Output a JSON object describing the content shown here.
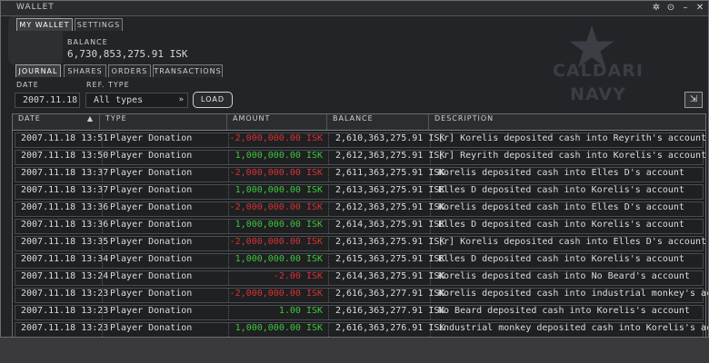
{
  "window": {
    "title": "WALLET"
  },
  "background": {
    "emblem_line1": "CALDARI",
    "emblem_line2": "NAVY"
  },
  "tabs_top": [
    "MY WALLET",
    "SETTINGS"
  ],
  "balance": {
    "label": "BALANCE",
    "value": "6,730,853,275.91",
    "unit": "ISK"
  },
  "tabs_sub": [
    "JOURNAL",
    "SHARES",
    "ORDERS",
    "TRANSACTIONS"
  ],
  "filters": {
    "date_label": "DATE",
    "date_value": "2007.11.18",
    "ref_type_label": "REF. TYPE",
    "ref_type_value": "All types",
    "load_label": "LOAD"
  },
  "table": {
    "columns": [
      "DATE",
      "TYPE",
      "AMOUNT",
      "BALANCE",
      "DESCRIPTION"
    ],
    "rows": [
      {
        "date": "2007.11.18 13:51",
        "type": "Player Donation",
        "amount": "-2,000,000.00",
        "balance": "2,610,363,275.91",
        "desc": "[r] Korelis deposited cash into Reyrith's account",
        "sign": "neg"
      },
      {
        "date": "2007.11.18 13:50",
        "type": "Player Donation",
        "amount": "1,000,000.00",
        "balance": "2,612,363,275.91",
        "desc": "[r] Reyrith deposited cash into Korelis's account",
        "sign": "pos"
      },
      {
        "date": "2007.11.18 13:37",
        "type": "Player Donation",
        "amount": "-2,000,000.00",
        "balance": "2,611,363,275.91",
        "desc": "Korelis deposited cash into Elles D's account",
        "sign": "neg"
      },
      {
        "date": "2007.11.18 13:37",
        "type": "Player Donation",
        "amount": "1,000,000.00",
        "balance": "2,613,363,275.91",
        "desc": "Elles D deposited cash into Korelis's account",
        "sign": "pos"
      },
      {
        "date": "2007.11.18 13:36",
        "type": "Player Donation",
        "amount": "-2,000,000.00",
        "balance": "2,612,363,275.91",
        "desc": "Korelis deposited cash into Elles D's account",
        "sign": "neg"
      },
      {
        "date": "2007.11.18 13:36",
        "type": "Player Donation",
        "amount": "1,000,000.00",
        "balance": "2,614,363,275.91",
        "desc": "Elles D deposited cash into Korelis's account",
        "sign": "pos"
      },
      {
        "date": "2007.11.18 13:35",
        "type": "Player Donation",
        "amount": "-2,000,000.00",
        "balance": "2,613,363,275.91",
        "desc": "[r] Korelis deposited cash into Elles D's account",
        "sign": "neg"
      },
      {
        "date": "2007.11.18 13:34",
        "type": "Player Donation",
        "amount": "1,000,000.00",
        "balance": "2,615,363,275.91",
        "desc": "Elles D deposited cash into Korelis's account",
        "sign": "pos"
      },
      {
        "date": "2007.11.18 13:24",
        "type": "Player Donation",
        "amount": "-2.00",
        "balance": "2,614,363,275.91",
        "desc": "Korelis deposited cash into No Beard's account",
        "sign": "neg"
      },
      {
        "date": "2007.11.18 13:23",
        "type": "Player Donation",
        "amount": "-2,000,000.00",
        "balance": "2,616,363,277.91",
        "desc": "Korelis deposited cash into industrial monkey's account",
        "sign": "neg"
      },
      {
        "date": "2007.11.18 13:23",
        "type": "Player Donation",
        "amount": "1.00",
        "balance": "2,616,363,277.91",
        "desc": "No Beard deposited cash into Korelis's account",
        "sign": "pos"
      },
      {
        "date": "2007.11.18 13:23",
        "type": "Player Donation",
        "amount": "1,000,000.00",
        "balance": "2,616,363,276.91",
        "desc": "industrial monkey deposited cash into Korelis's account",
        "sign": "pos"
      }
    ],
    "currency": "ISK"
  },
  "colors": {
    "negative": "#d83232",
    "positive": "#3cc83c"
  }
}
